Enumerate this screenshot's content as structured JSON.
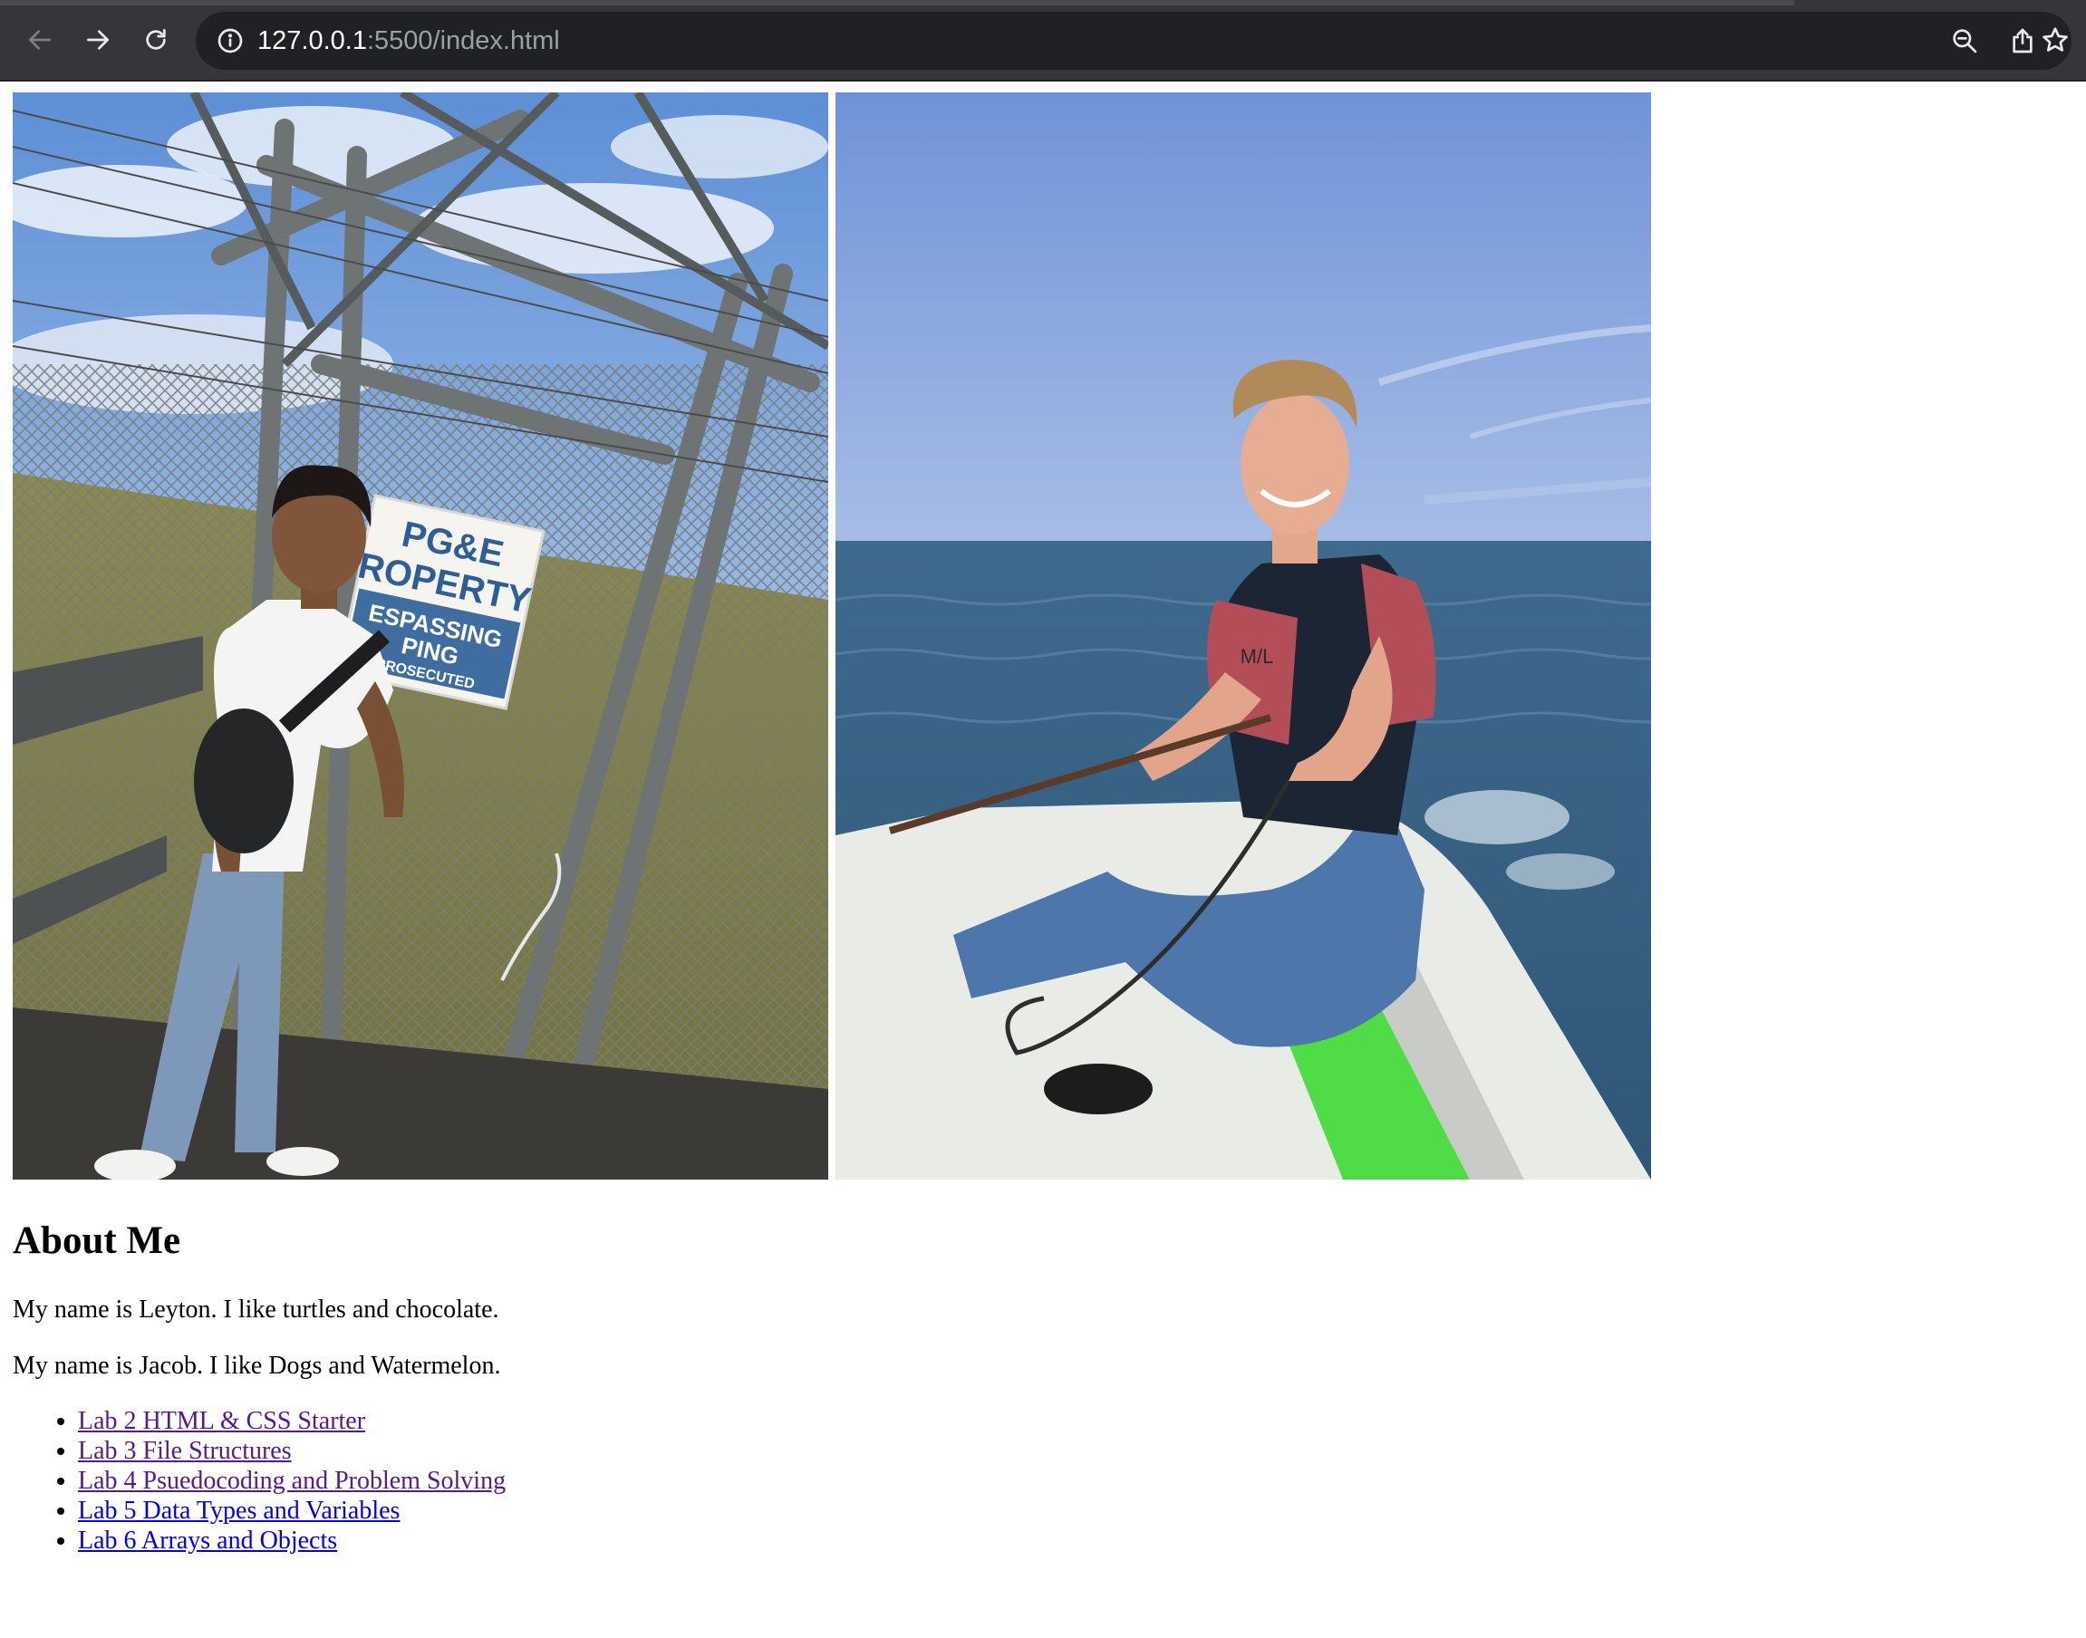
{
  "browser": {
    "url_host": "127.0.0.1",
    "url_rest": ":5500/index.html",
    "icons": {
      "back": "arrow-left-icon",
      "forward": "arrow-right-icon",
      "reload": "reload-icon",
      "site_info": "info-icon",
      "zoom": "zoom-out-icon",
      "share": "share-icon",
      "bookmark": "star-icon"
    }
  },
  "page": {
    "heading": "About Me",
    "bio_1": "My name is Leyton. I like turtles and chocolate.",
    "bio_2": "My name is Jacob. I like Dogs and Watermelon.",
    "links": [
      {
        "label": "Lab 2 HTML & CSS Starter",
        "visited": true
      },
      {
        "label": "Lab 3 File Structures",
        "visited": true
      },
      {
        "label": "Lab 4 Psuedocoding and Problem Solving",
        "visited": true
      },
      {
        "label": "Lab 5 Data Types and Variables",
        "visited": false
      },
      {
        "label": "Lab 6 Arrays and Objects",
        "visited": false
      }
    ],
    "photo_sign_text": [
      "PG&E",
      "ROPERTY",
      "ESPASSING",
      "PING",
      "PROSECUTED"
    ],
    "photo_vest_text": "M/L"
  },
  "colors": {
    "chrome_bg": "#35363a",
    "omnibox_bg": "#202124",
    "link_visited": "#551a8b",
    "link_unvisited": "#0000ee"
  }
}
